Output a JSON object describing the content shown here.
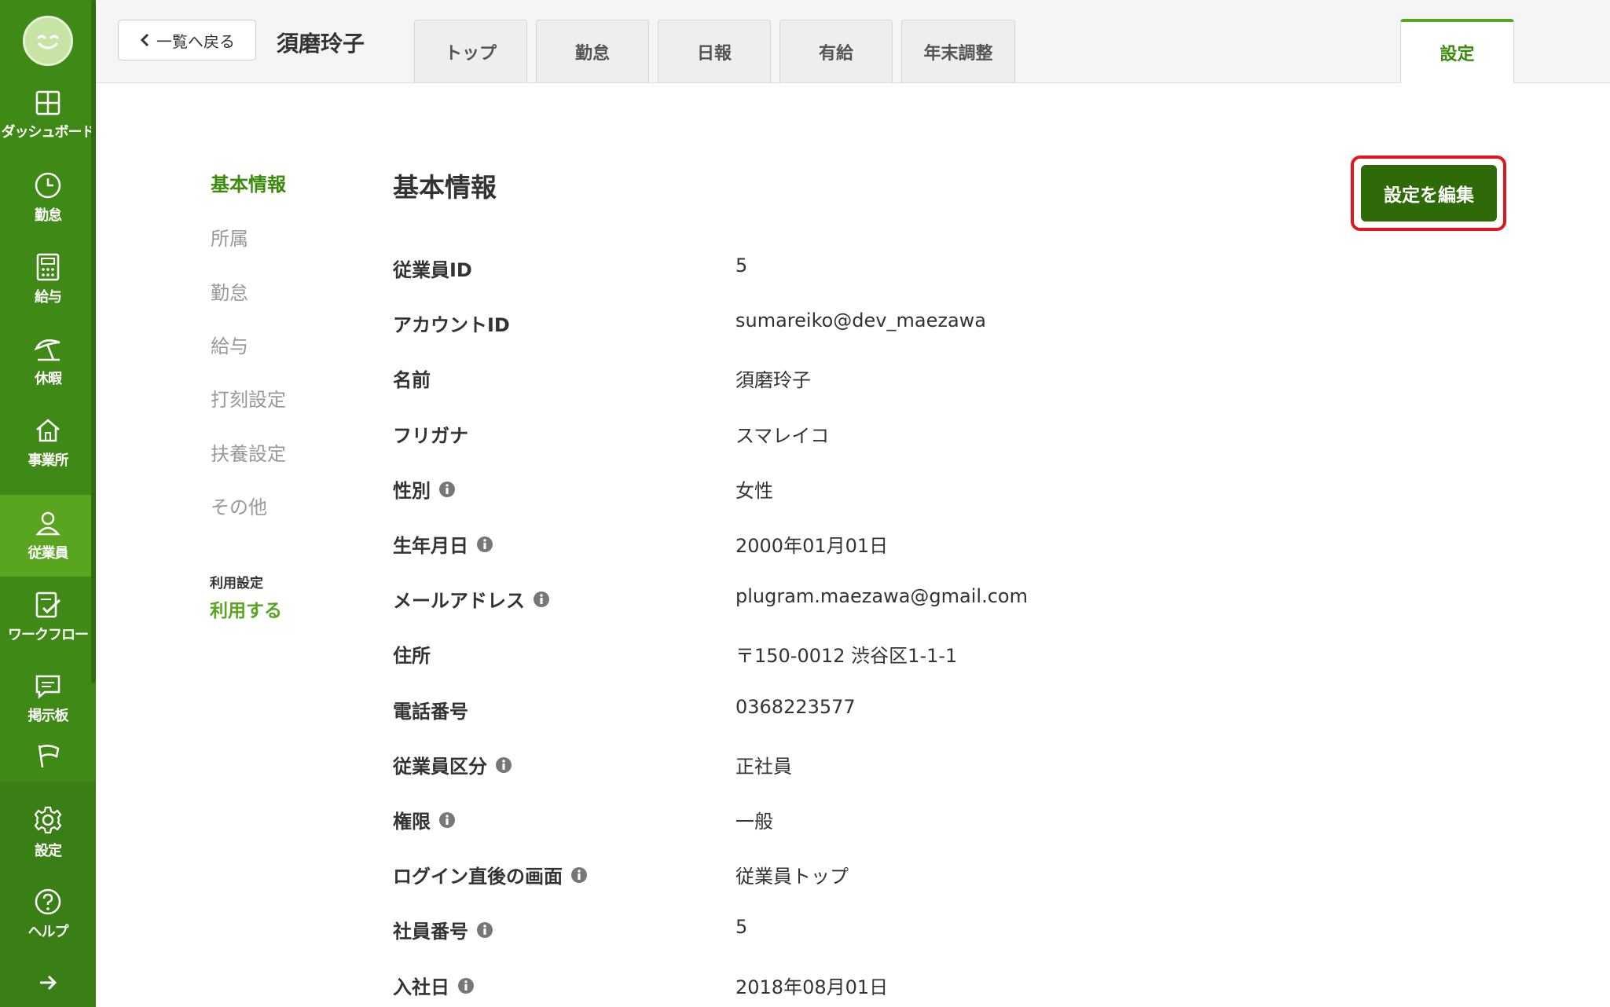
{
  "sidebar": {
    "items": [
      {
        "label": "ダッシュボード",
        "icon": "dashboard-icon"
      },
      {
        "label": "勤怠",
        "icon": "clock-icon"
      },
      {
        "label": "給与",
        "icon": "calculator-icon"
      },
      {
        "label": "休暇",
        "icon": "beach-umbrella-icon"
      },
      {
        "label": "事業所",
        "icon": "home-icon"
      },
      {
        "label": "従業員",
        "icon": "user-icon",
        "active": true
      },
      {
        "label": "ワークフロー",
        "icon": "checklist-icon"
      },
      {
        "label": "掲示板",
        "icon": "chat-icon"
      },
      {
        "label": "",
        "icon": "flag-icon"
      }
    ],
    "lower_items": [
      {
        "label": "設定",
        "icon": "gear-icon"
      },
      {
        "label": "ヘルプ",
        "icon": "help-icon"
      }
    ]
  },
  "header": {
    "back_label": "一覧へ戻る",
    "employee_name": "須磨玲子",
    "tabs": [
      "トップ",
      "勤怠",
      "日報",
      "有給",
      "年末調整"
    ],
    "active_tab": "設定"
  },
  "subnav": {
    "items": [
      "基本情報",
      "所属",
      "勤怠",
      "給与",
      "打刻設定",
      "扶養設定",
      "その他"
    ],
    "usage_label": "利用設定",
    "usage_value": "利用する"
  },
  "main": {
    "title": "基本情報",
    "edit_button": "設定を編集",
    "fields": [
      {
        "label": "従業員ID",
        "value": "5",
        "info": false
      },
      {
        "label": "アカウントID",
        "value": "sumareiko@dev_maezawa",
        "info": false
      },
      {
        "label": "名前",
        "value": "須磨玲子",
        "info": false
      },
      {
        "label": "フリガナ",
        "value": "スマレイコ",
        "info": false
      },
      {
        "label": "性別",
        "value": "女性",
        "info": true
      },
      {
        "label": "生年月日",
        "value": "2000年01月01日",
        "info": true
      },
      {
        "label": "メールアドレス",
        "value": "plugram.maezawa@gmail.com",
        "info": true
      },
      {
        "label": "住所",
        "value": "〒150-0012 渋谷区1-1-1",
        "info": false
      },
      {
        "label": "電話番号",
        "value": "0368223577",
        "info": false
      },
      {
        "label": "従業員区分",
        "value": "正社員",
        "info": true
      },
      {
        "label": "権限",
        "value": "一般",
        "info": true
      },
      {
        "label": "ログイン直後の画面",
        "value": "従業員トップ",
        "info": true
      },
      {
        "label": "社員番号",
        "value": "5",
        "info": true
      },
      {
        "label": "入社日",
        "value": "2018年08月01日",
        "info": true
      }
    ]
  },
  "colors": {
    "sidebar": "#3f8a17",
    "sidebar_active": "#5aa51f",
    "accent": "#3d8b0b",
    "button": "#2e6b08",
    "highlight": "#e0161d"
  }
}
